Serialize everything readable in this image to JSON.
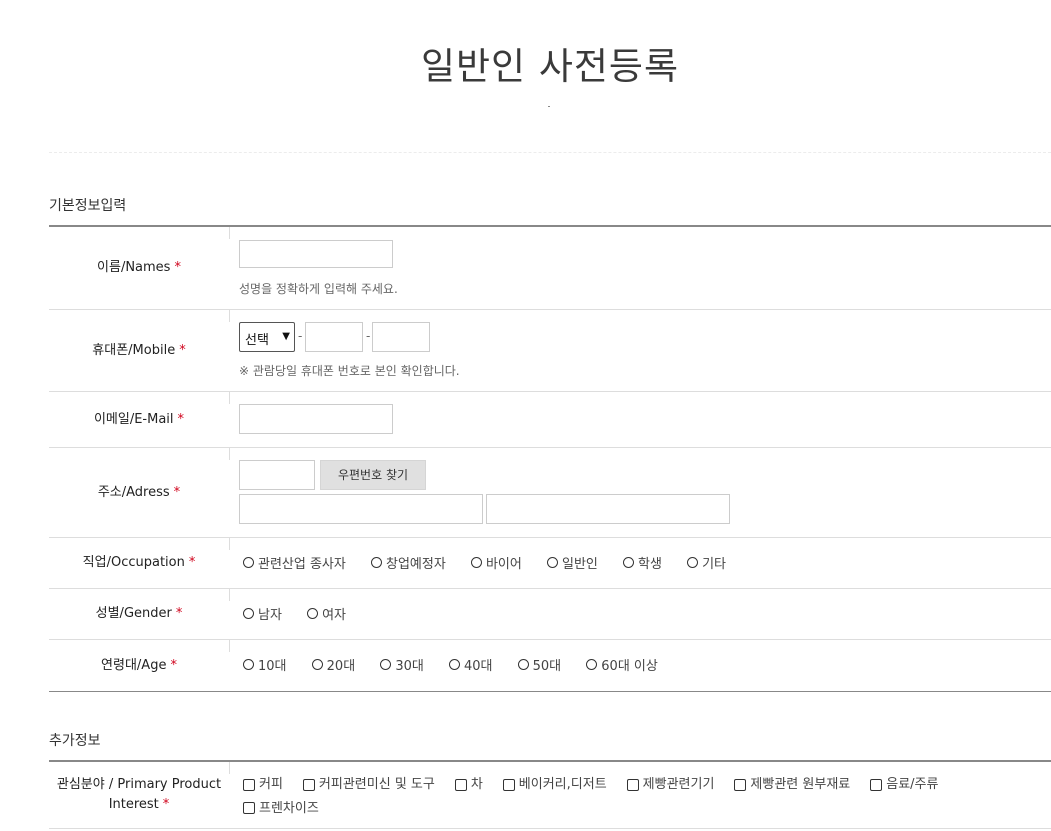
{
  "page": {
    "title": "일반인 사전등록"
  },
  "sections": {
    "basic": "기본정보입력",
    "extra": "추가정보"
  },
  "fields": {
    "name": {
      "label": "이름/Names",
      "required_mark": "*",
      "help": "성명을 정확하게 입력해 주세요."
    },
    "mobile": {
      "label": "휴대폰/Mobile",
      "required_mark": "*",
      "select_value": "선택",
      "separator": "-",
      "help": "※ 관람당일 휴대폰 번호로 본인 확인합니다."
    },
    "email": {
      "label": "이메일/E-Mail",
      "required_mark": "*"
    },
    "address": {
      "label": "주소/Adress",
      "required_mark": "*",
      "zip_button": "우편번호 찾기"
    },
    "occupation": {
      "label": "직업/Occupation",
      "required_mark": "*",
      "options": [
        "관련산업 종사자",
        "창업예정자",
        "바이어",
        "일반인",
        "학생",
        "기타"
      ]
    },
    "gender": {
      "label": "성별/Gender",
      "required_mark": "*",
      "options": [
        "남자",
        "여자"
      ]
    },
    "age": {
      "label": "연령대/Age",
      "required_mark": "*",
      "options": [
        "10대",
        "20대",
        "30대",
        "40대",
        "50대",
        "60대 이상"
      ]
    },
    "interest": {
      "label": "관심분야 / Primary Product Interest",
      "required_mark": "*",
      "options": [
        "커피",
        "커피관련미신 및 도구",
        "차",
        "베이커리,디저트",
        "제빵관련기기",
        "제빵관련 원부재료",
        "음료/주류",
        "프렌차이즈"
      ]
    }
  }
}
